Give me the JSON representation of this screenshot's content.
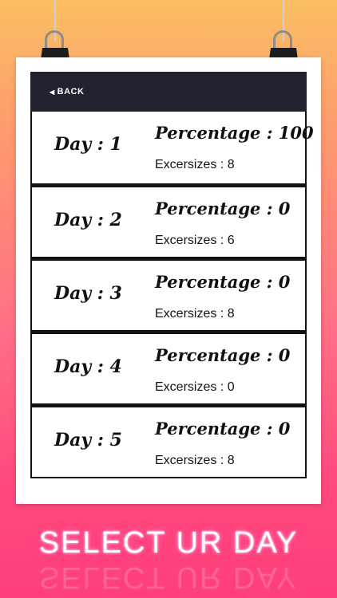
{
  "header": {
    "back_label": "BACK",
    "back_icon": "◀"
  },
  "days": [
    {
      "day": "Day : 1",
      "percentage": "Percentage : 100",
      "exercises": "Excersizes : 8"
    },
    {
      "day": "Day : 2",
      "percentage": "Percentage : 0",
      "exercises": "Excersizes : 6"
    },
    {
      "day": "Day : 3",
      "percentage": "Percentage : 0",
      "exercises": "Excersizes : 8"
    },
    {
      "day": "Day : 4",
      "percentage": "Percentage : 0",
      "exercises": "Excersizes : 0"
    },
    {
      "day": "Day : 5",
      "percentage": "Percentage : 0",
      "exercises": "Excersizes : 8"
    }
  ],
  "footer": {
    "title": "SELECT UR DAY"
  },
  "colors": {
    "header_bg": "#20222d",
    "gradient_top": "#fbbf62",
    "gradient_bottom": "#ff3f7b"
  }
}
